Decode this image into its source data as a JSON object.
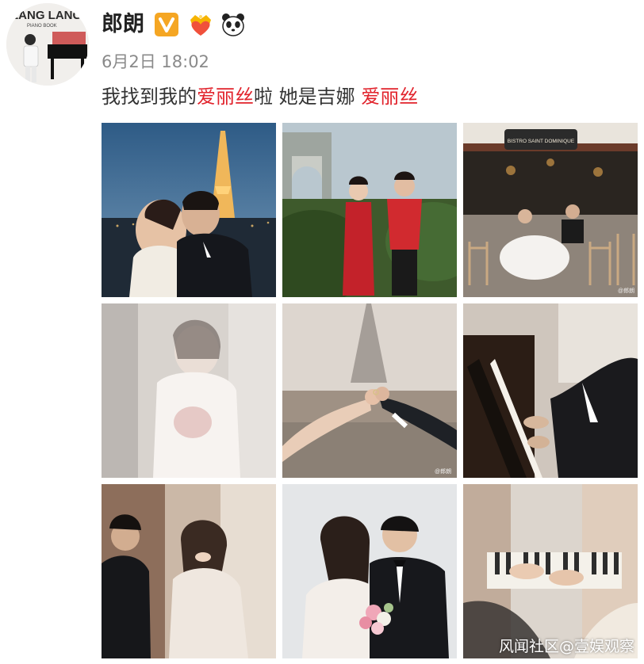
{
  "post": {
    "username": "郎朗",
    "timestamp": "6月2日 18:02",
    "text_parts": {
      "part1": "我找到我的",
      "hl1": "爱丽丝",
      "part2": "啦 她是吉娜 ",
      "hl2": "爱丽丝"
    },
    "badges": [
      "verified-v-icon",
      "crown-heart-icon",
      "panda-icon"
    ]
  },
  "avatar": {
    "text_line1": "LANG LANG",
    "text_line2": "PIANO BOOK"
  },
  "photos": [
    {
      "name": "photo-eiffel-night-kiss",
      "overlay": ""
    },
    {
      "name": "photo-arc-red-qipao",
      "overlay": ""
    },
    {
      "name": "photo-bistro-cafe",
      "overlay": "BISTRO SAINT DOMINIQUE",
      "wm": "@郎朗"
    },
    {
      "name": "photo-veil-bride",
      "overlay": ""
    },
    {
      "name": "photo-rings-eiffel",
      "overlay": "",
      "wm": "@郎朗"
    },
    {
      "name": "photo-piano-hands",
      "overlay": ""
    },
    {
      "name": "photo-bride-laughing",
      "overlay": ""
    },
    {
      "name": "photo-couple-portrait",
      "overlay": ""
    },
    {
      "name": "photo-piano-keys-blur",
      "overlay": ""
    }
  ],
  "watermark": "风闻社区@壹娱观察",
  "colors": {
    "highlight": "#e1222b",
    "verified": "#f5a623",
    "text": "#333333",
    "muted": "#8a8a8a"
  }
}
